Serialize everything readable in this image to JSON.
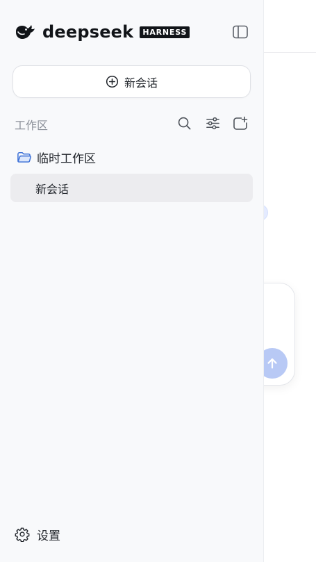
{
  "brand": {
    "name": "deepseek",
    "badge": "HARNESS",
    "logo_icon": "whale-icon"
  },
  "sidebar": {
    "toggle_icon": "sidebar-toggle-icon",
    "new_chat": {
      "label": "新会话",
      "icon": "plus-circle-icon"
    },
    "workspace": {
      "title": "工作区",
      "tools": [
        {
          "name": "search-icon"
        },
        {
          "name": "filter-icon"
        },
        {
          "name": "new-folder-icon"
        }
      ]
    },
    "folder": {
      "label": "临时工作区",
      "icon": "folder-open-icon",
      "color": "#3f73d8"
    },
    "sessions": [
      {
        "label": "新会话",
        "selected": true
      }
    ],
    "settings": {
      "label": "设置",
      "icon": "gear-icon"
    }
  },
  "main": {
    "send_icon": "arrow-up-icon",
    "accent": "#b8c9f5"
  }
}
